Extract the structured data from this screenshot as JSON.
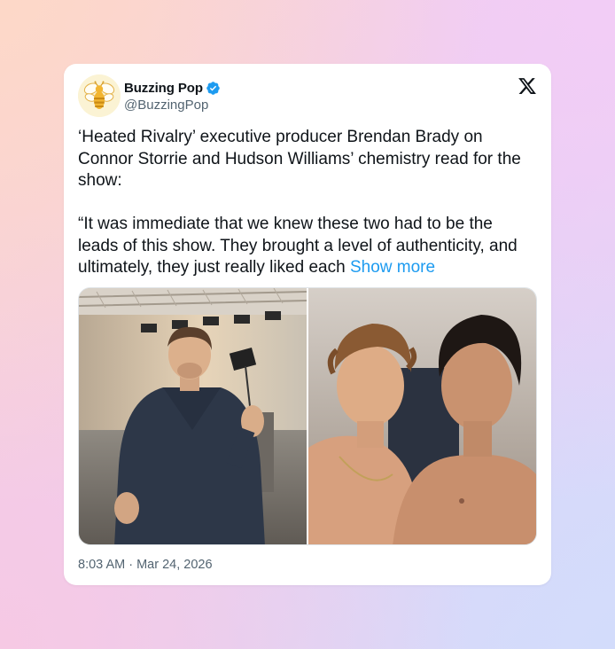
{
  "account": {
    "display_name": "Buzzing Pop",
    "handle": "@BuzzingPop",
    "verified": true,
    "avatar_icon": "bee-logo-icon"
  },
  "platform_icon": "x-logo-icon",
  "tweet": {
    "paragraph_1": "‘Heated Rivalry’ executive producer Brendan Brady on Connor Storrie and Hudson Williams’ chemistry read for the show:",
    "paragraph_2": "“It was immediate that we knew these two had to be the leads of this show. They brought a level of authenticity, and ultimately, they just really liked each",
    "show_more_label": "Show more",
    "timestamp": "8:03 AM · Mar 24, 2026"
  },
  "media": [
    {
      "kind": "photo",
      "subject": "man-speaking-on-set-photo"
    },
    {
      "kind": "photo",
      "subject": "two-men-close-together-photo"
    }
  ],
  "colors": {
    "link": "#1d9bf0",
    "verified_badge": "#1d9bf0",
    "text_primary": "#0f1419",
    "text_secondary": "#536471"
  }
}
